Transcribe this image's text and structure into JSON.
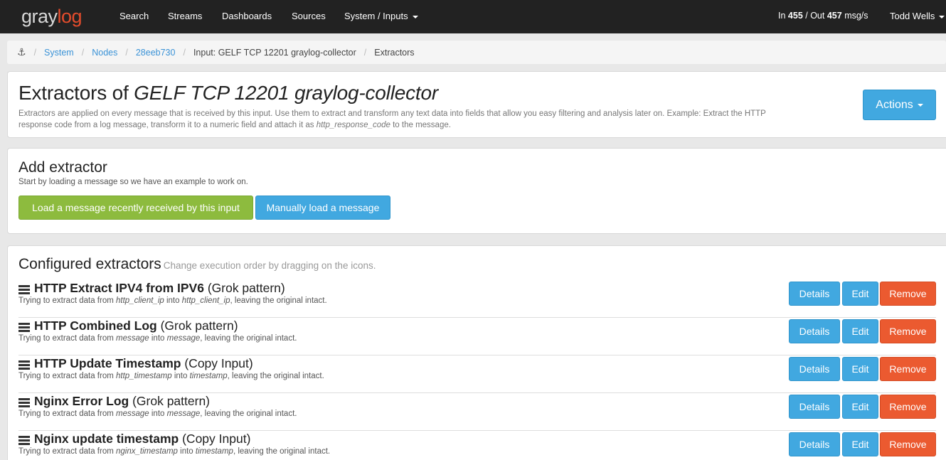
{
  "brand": {
    "part1": "gray",
    "part2": "log"
  },
  "nav": {
    "search": "Search",
    "streams": "Streams",
    "dashboards": "Dashboards",
    "sources": "Sources",
    "system": "System / Inputs",
    "throughput_in_label": "In",
    "throughput_in": "455",
    "throughput_sep": "/ Out",
    "throughput_out": "457",
    "throughput_unit": "msg/s",
    "user": "Todd Wells"
  },
  "breadcrumb": {
    "system": "System",
    "nodes": "Nodes",
    "node_id": "28eeb730",
    "input": "Input: GELF TCP 12201 graylog-collector",
    "current": "Extractors"
  },
  "header": {
    "title_prefix": "Extractors of",
    "title_input": "GELF TCP 12201 graylog-collector",
    "desc_part1": "Extractors are applied on every message that is received by this input. Use them to extract and transform any text data into fields that allow you easy filtering and analysis later on. Example: Extract the HTTP response code from a log message, transform it to a numeric field and attach it as",
    "desc_field": "http_response_code",
    "desc_part2": "to the message.",
    "actions_label": "Actions"
  },
  "add_extractor": {
    "title": "Add extractor",
    "desc": "Start by loading a message so we have an example to work on.",
    "load_recent_label": "Load a message recently received by this input",
    "manual_label": "Manually load a message"
  },
  "configured": {
    "title": "Configured extractors",
    "hint": "Change execution order by dragging on the icons.",
    "sub_prefix": "Trying to extract data from",
    "sub_into": "into",
    "sub_suffix": ", leaving the original intact.",
    "details_label": "Details",
    "edit_label": "Edit",
    "remove_label": "Remove",
    "items": [
      {
        "name": "HTTP Extract IPV4 from IPV6",
        "type": "(Grok pattern)",
        "source": "http_client_ip",
        "target": "http_client_ip"
      },
      {
        "name": "HTTP Combined Log",
        "type": "(Grok pattern)",
        "source": "message",
        "target": "message"
      },
      {
        "name": "HTTP Update Timestamp",
        "type": "(Copy Input)",
        "source": "http_timestamp",
        "target": "timestamp"
      },
      {
        "name": "Nginx Error Log",
        "type": "(Grok pattern)",
        "source": "message",
        "target": "message"
      },
      {
        "name": "Nginx update timestamp",
        "type": "(Copy Input)",
        "source": "nginx_timestamp",
        "target": "timestamp"
      }
    ]
  },
  "colors": {
    "navbar": "#222222",
    "primary": "#41a8e0",
    "success": "#8dbb3e",
    "danger": "#eb5a30",
    "brand_red": "#e44c2c"
  }
}
